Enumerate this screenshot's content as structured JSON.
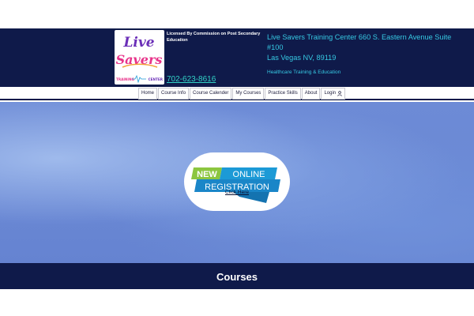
{
  "logo": {
    "line1": "Live",
    "line2": "Savers",
    "sub_left": "TRAINING",
    "sub_right": "CENTER"
  },
  "header": {
    "license": "Licensed By Commission on Post Secondary Education",
    "phone": "702-623-8616",
    "address_line1": "Live Savers Training Center 660 S. Eastern Avenue Suite #100",
    "address_line2": "Las Vegas NV, 89119",
    "tagline": "Healthcare Training & Education"
  },
  "nav": [
    {
      "label": "Home"
    },
    {
      "label": "Course Info"
    },
    {
      "label": "Course Calender"
    },
    {
      "label": "My Courses"
    },
    {
      "label": "Practice Skills"
    },
    {
      "label": "About"
    },
    {
      "label": "Login"
    }
  ],
  "hero": {
    "badge_new": "NEW",
    "badge_online": "ONLINE",
    "badge_registration": "REGISTRATION",
    "click_here": "Click Here"
  },
  "courses": {
    "title": "Courses"
  },
  "colors": {
    "navy": "#0f1a4a",
    "teal": "#36c9e3",
    "green": "#8cc63f",
    "blue": "#1c9ad6"
  }
}
